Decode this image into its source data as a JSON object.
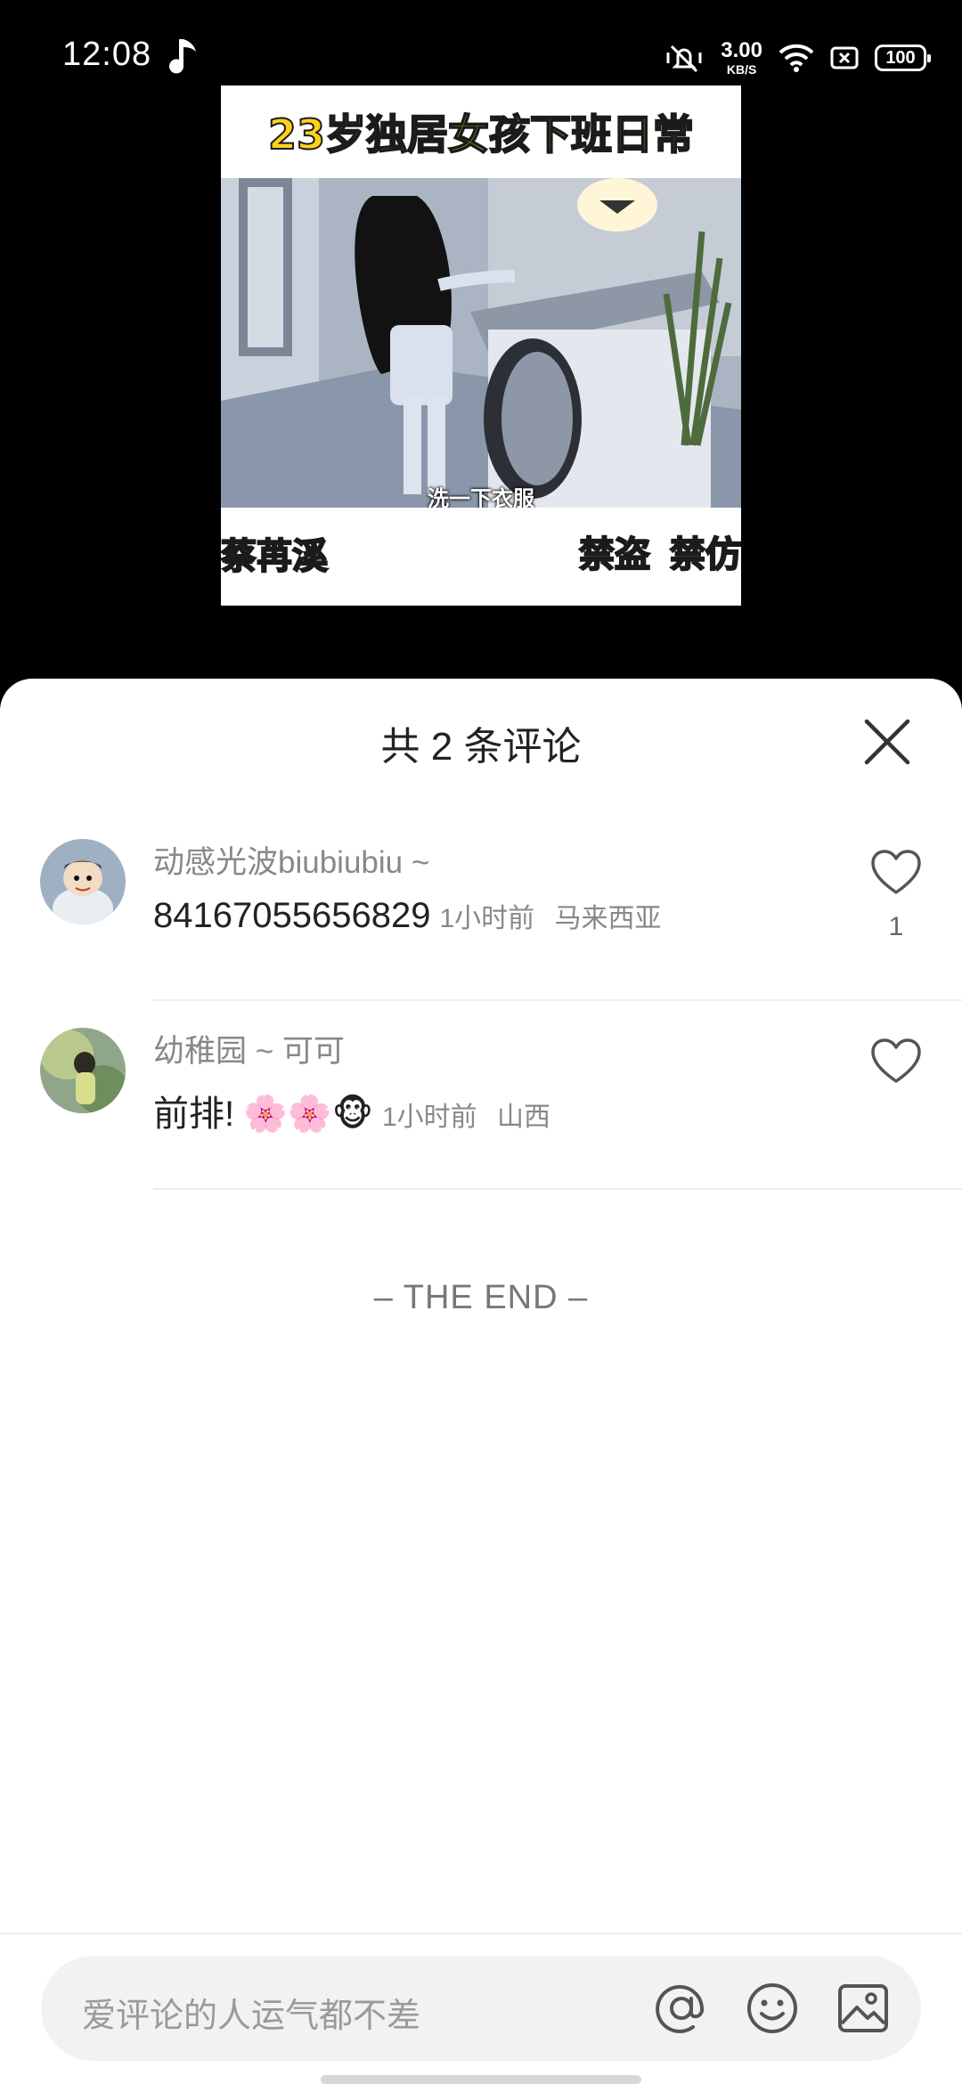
{
  "status_bar": {
    "time": "12:08",
    "net_speed_value": "3.00",
    "net_speed_unit": "KB/S",
    "battery": "100",
    "icons": [
      "music-note-icon",
      "mute-vibrate-icon",
      "wifi-icon",
      "sim-card-icon",
      "battery-icon"
    ]
  },
  "video": {
    "title": "23岁独居女孩下班日常",
    "caption": "洗一下衣服",
    "watermark_left": "蔡苒溪",
    "watermark_right_1": "禁盗",
    "watermark_right_2": "禁仿"
  },
  "sheet": {
    "title": "共 2 条评论",
    "close_icon": "close-icon"
  },
  "comments": [
    {
      "name": "动感光波biubiubiu ~",
      "text": "84167055656829",
      "time": "1小时前",
      "location": "马来西亚",
      "likes": "1"
    },
    {
      "name": "幼稚园 ~ 可可",
      "text": "前排!",
      "emojis": "🌸🌸🐵",
      "time": "1小时前",
      "location": "山西",
      "likes": ""
    }
  ],
  "end_text": "– THE END –",
  "input": {
    "placeholder": "爱评论的人运气都不差",
    "icons": [
      "at-icon",
      "emoji-icon",
      "image-icon"
    ]
  },
  "colors": {
    "background_top": "#000000",
    "sheet": "#ffffff",
    "watermark_yellow": "#ffd21a",
    "input_bg": "#f2f2f2"
  }
}
